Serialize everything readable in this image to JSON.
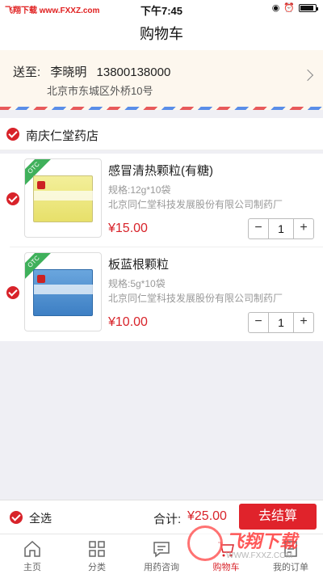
{
  "status_bar": {
    "watermark_text": "飞翔下载 www.FXXZ.com",
    "time": "下午7:45"
  },
  "nav": {
    "title": "购物车"
  },
  "address": {
    "label": "送至:",
    "name": "李晓明",
    "phone": "13800138000",
    "street": "北京市东城区外桥10号"
  },
  "store": {
    "name": "南庆仁堂药店",
    "checked": true
  },
  "products": [
    {
      "title": "感冒清热颗粒(有糖)",
      "spec": "规格:12g*10袋",
      "maker": "北京同仁堂科技发展股份有限公司制药厂",
      "price": "¥15.00",
      "qty": "1",
      "badge": "OTC",
      "checked": true
    },
    {
      "title": "板蓝根颗粒",
      "spec": "规格:5g*10袋",
      "maker": "北京同仁堂科技发展股份有限公司制药厂",
      "price": "¥10.00",
      "qty": "1",
      "badge": "OTC",
      "checked": true
    }
  ],
  "summary": {
    "select_all": "全选",
    "total_label": "合计:",
    "total_value": "¥25.00",
    "checkout": "去结算"
  },
  "tabs": [
    {
      "label": "主页",
      "icon": "home-icon"
    },
    {
      "label": "分类",
      "icon": "grid-icon"
    },
    {
      "label": "用药咨询",
      "icon": "chat-icon"
    },
    {
      "label": "购物车",
      "icon": "cart-icon",
      "active": true
    },
    {
      "label": "我的订单",
      "icon": "orders-icon"
    }
  ],
  "watermark": {
    "text": "飞翔下载",
    "sub": "WWW.FXXZ.COM"
  },
  "colors": {
    "accent": "#d8232a",
    "price": "#d8232a",
    "otc": "#3fb05b"
  }
}
